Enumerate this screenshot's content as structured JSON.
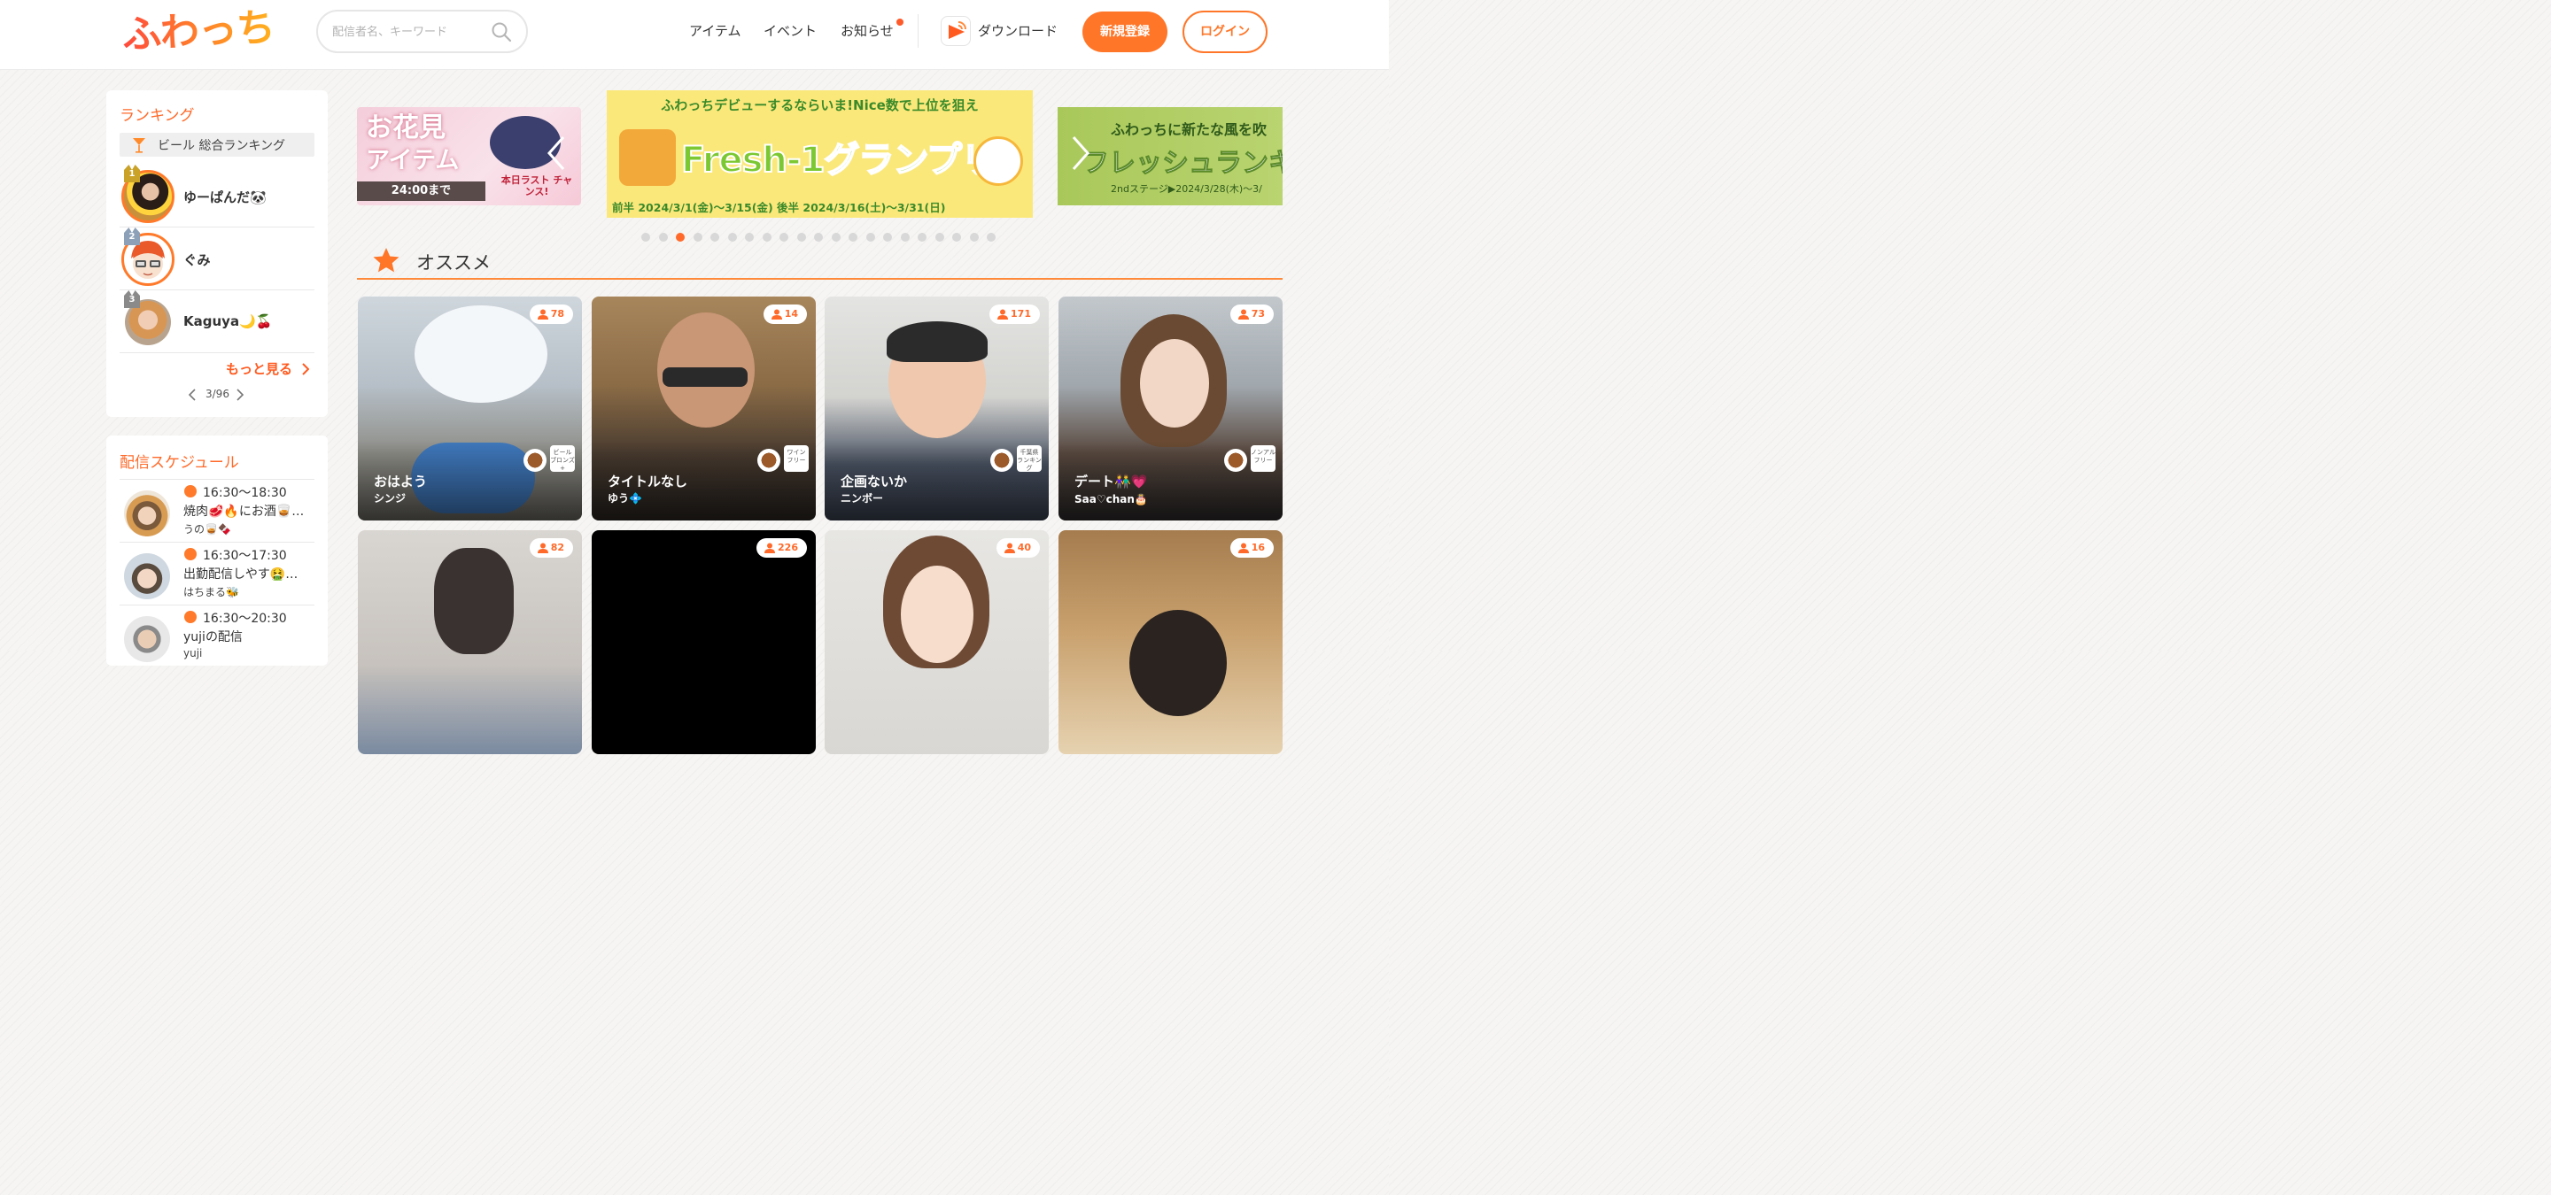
{
  "header": {
    "logo": "ふわっち",
    "search_placeholder": "配信者名、キーワード",
    "nav": [
      "アイテム",
      "イベント",
      "お知らせ"
    ],
    "download": "ダウンロード",
    "signup": "新規登録",
    "login": "ログイン"
  },
  "ranking": {
    "title": "ランキング",
    "category": "ビール 総合ランキング",
    "items": [
      {
        "rank": "1",
        "name": "ゆーぱんだ🐼"
      },
      {
        "rank": "2",
        "name": "ぐみ"
      },
      {
        "rank": "3",
        "name": "Kaguya🌙🍒"
      }
    ],
    "more": "もっと見る",
    "pager": "3/96"
  },
  "schedule": {
    "title": "配信スケジュール",
    "items": [
      {
        "time": "16:30〜18:30",
        "title": "焼肉🥩🔥にお酒🥃…",
        "user": "うの🥃🍫"
      },
      {
        "time": "16:30〜17:30",
        "title": "出勤配信しやす🤮…",
        "user": "はちまる🐝"
      },
      {
        "time": "16:30〜20:30",
        "title": "yujiの配信",
        "user": "yuji"
      }
    ]
  },
  "banners": {
    "left": {
      "line1": "お花見",
      "line2": "アイテム",
      "time": "24:00まで",
      "badge": "本日ラスト チャンス!"
    },
    "main": {
      "top": "ふわっちデビューするならいま!Nice数で上位を狙え",
      "title": "Fresh-1グランプリ",
      "dates": "前半 2024/3/1(金)〜3/15(金)  後半 2024/3/16(土)〜3/31(日)"
    },
    "right": {
      "top": "ふわっちに新たな風を吹",
      "title": "フレッシュランキ",
      "stage": "2ndステージ▶2024/3/28(木)〜3/"
    }
  },
  "carousel": {
    "total": 21,
    "active": 2
  },
  "recommend": {
    "title": "オススメ",
    "tiles": [
      {
        "count": "78",
        "title": "おはよう",
        "user": "シンジ",
        "tag": "ビール ブロンズ+"
      },
      {
        "count": "14",
        "title": "タイトルなし",
        "user": "ゆう💠",
        "tag": "ワイン フリー"
      },
      {
        "count": "171",
        "title": "企画ないか",
        "user": "ニンボー",
        "tag": "千葉県 ランキング"
      },
      {
        "count": "73",
        "title": "デート👫💗",
        "user": "Saa♡chan🎂",
        "tag": "ノンアル フリー"
      },
      {
        "count": "82",
        "title": "",
        "user": "",
        "tag": ""
      },
      {
        "count": "226",
        "title": "",
        "user": "",
        "tag": ""
      },
      {
        "count": "40",
        "title": "",
        "user": "",
        "tag": ""
      },
      {
        "count": "16",
        "title": "",
        "user": "",
        "tag": ""
      }
    ]
  },
  "colors": {
    "accent": "#ff7628",
    "accent_text": "#ff6a2a"
  }
}
